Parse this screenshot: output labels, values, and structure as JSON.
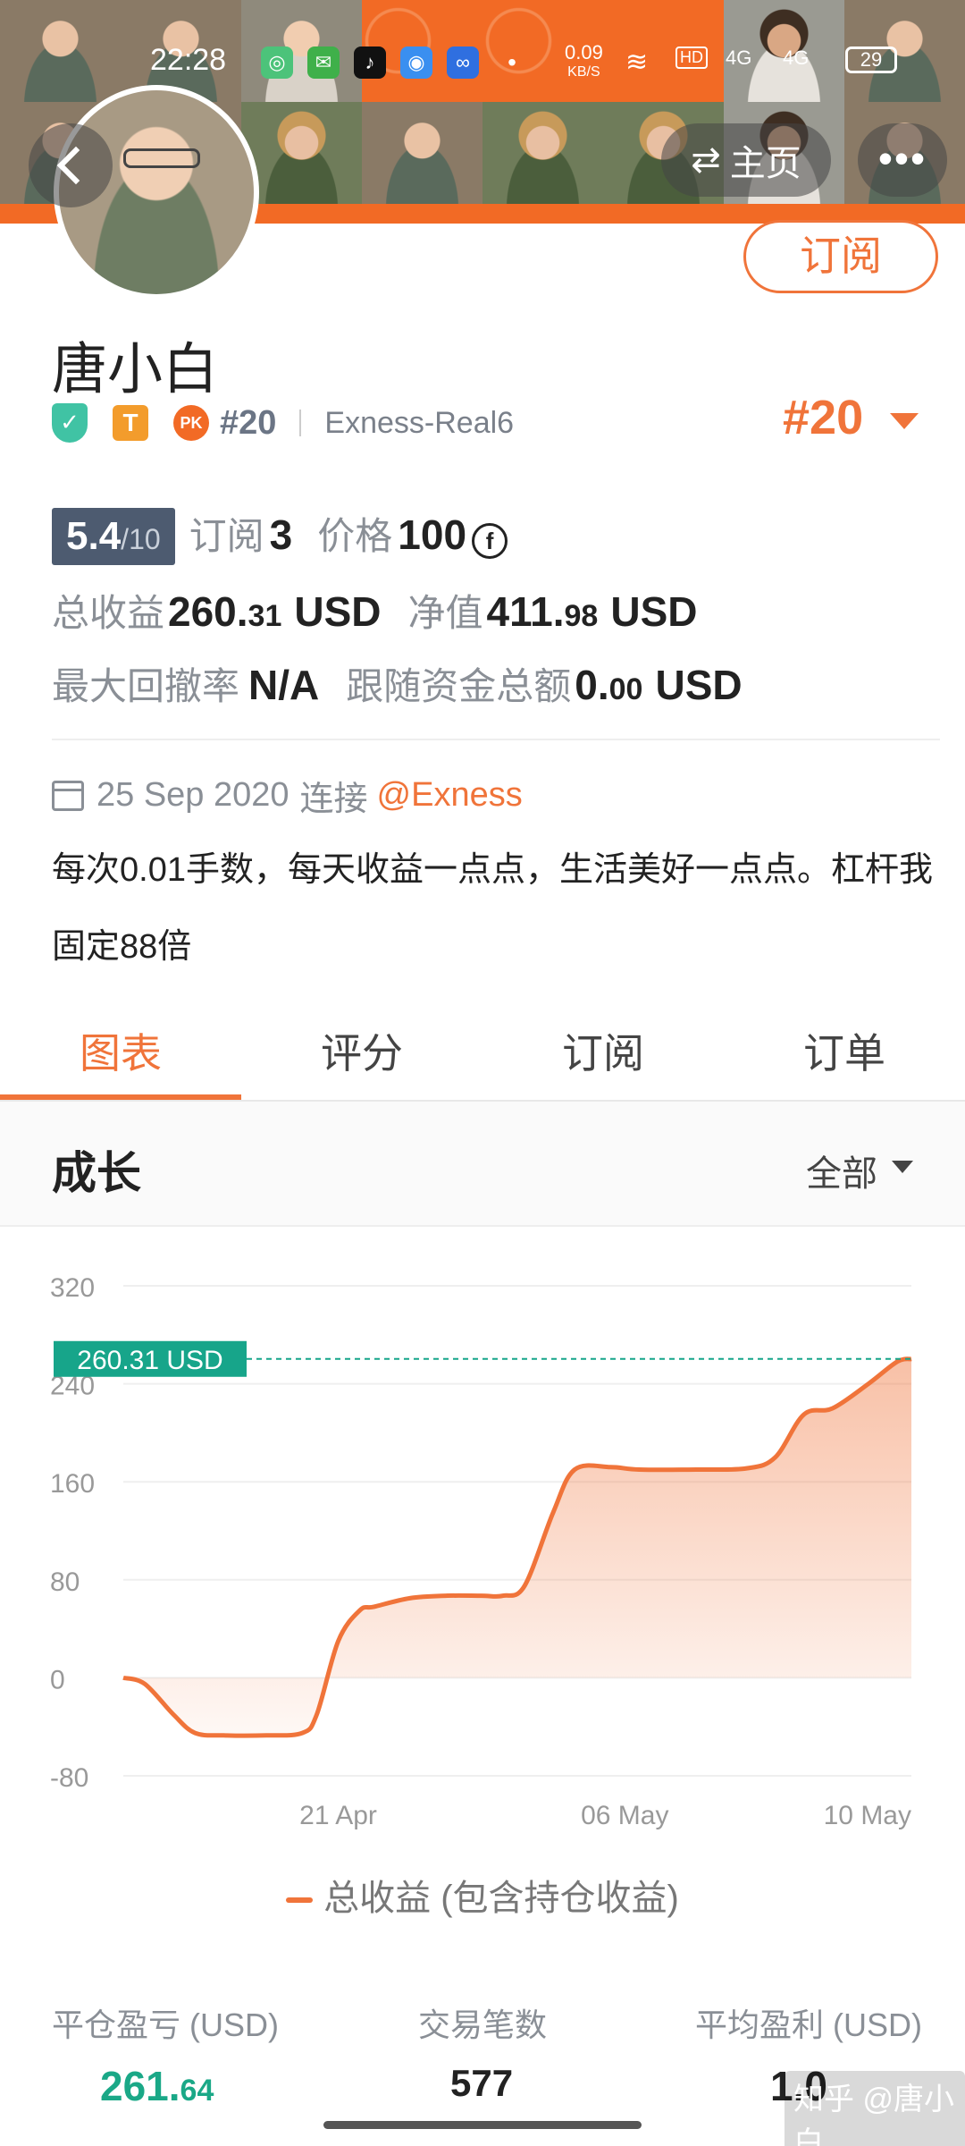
{
  "status_bar": {
    "time": "22:28",
    "net_speed_value": "0.09",
    "net_speed_unit": "KB/S",
    "hd": "HD",
    "network": "4G",
    "battery": "29"
  },
  "header": {
    "home_label": "主页",
    "more_label": "•••",
    "subscribe_label": "订阅"
  },
  "profile": {
    "name": "唐小白",
    "badge_t": "T",
    "badge_pk": "PK",
    "rank_small": "#20",
    "server": "Exness-Real6",
    "rank_big": "#20"
  },
  "stats": {
    "score_main": "5.4",
    "score_total": "/10",
    "subscribe_label": "订阅",
    "subscribe_count": "3",
    "price_label": "价格",
    "price_value": "100",
    "price_coin": "f",
    "total_profit_label": "总收益",
    "total_profit_int": "260.",
    "total_profit_frac": "31",
    "total_profit_unit": "USD",
    "equity_label": "净值",
    "equity_int": "411.",
    "equity_frac": "98",
    "equity_unit": "USD",
    "max_drawdown_label": "最大回撤率",
    "max_drawdown_value": "N/A",
    "follow_funds_label": "跟随资金总额",
    "follow_funds_int": "0.",
    "follow_funds_frac": "00",
    "follow_funds_unit": "USD"
  },
  "connection": {
    "date": "25 Sep 2020",
    "connect_label": "连接",
    "broker": "@Exness"
  },
  "description": "每次0.01手数，每天收益一点点，生活美好一点点。杠杆我固定88倍",
  "tabs": [
    {
      "label": "图表",
      "active": true
    },
    {
      "label": "评分",
      "active": false
    },
    {
      "label": "订阅",
      "active": false
    },
    {
      "label": "订单",
      "active": false
    }
  ],
  "section": {
    "title": "成长",
    "range": "全部"
  },
  "chart_data": {
    "type": "area",
    "y_ticks": [
      "320",
      "240",
      "160",
      "80",
      "0",
      "-80"
    ],
    "ylim": [
      -80,
      320
    ],
    "x_tick_labels": [
      "21 Apr",
      "06 May",
      "10 May"
    ],
    "x_tick_positions": [
      3.0,
      7.0,
      11.0
    ],
    "xlim": [
      0,
      11.0
    ],
    "current_label": "260.31 USD",
    "current_value": 260.31,
    "series": [
      {
        "name": "总收益 (包含持仓收益)",
        "x": [
          0,
          0.3,
          0.7,
          1.0,
          1.4,
          2.0,
          2.5,
          2.7,
          3.0,
          3.3,
          3.5,
          4.0,
          4.5,
          5.0,
          5.3,
          5.6,
          6.0,
          6.3,
          6.8,
          7.2,
          8.0,
          8.7,
          9.1,
          9.5,
          9.9,
          10.4,
          10.8,
          11.0
        ],
        "y": [
          0,
          -5,
          -30,
          -45,
          -47,
          -47,
          -45,
          -30,
          30,
          55,
          58,
          65,
          67,
          67,
          67,
          75,
          135,
          170,
          172,
          170,
          170,
          171,
          180,
          215,
          220,
          240,
          258,
          260.31
        ],
        "color": "#f0743a"
      }
    ],
    "legend_position": "bottom",
    "grid": true
  },
  "bottom_stats": [
    {
      "label": "平仓盈亏 (USD)",
      "value_int": "261.",
      "value_frac": "64"
    },
    {
      "label": "交易笔数",
      "value": "577"
    },
    {
      "label": "平均盈利 (USD)",
      "value": "1.0"
    }
  ],
  "watermark": "知乎 @唐小白"
}
